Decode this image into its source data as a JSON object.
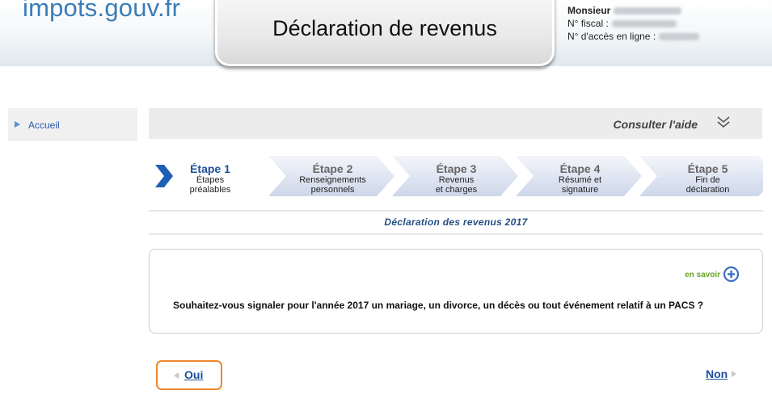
{
  "header": {
    "logo_text": "impots.gouv.fr",
    "title": "Déclaration de revenus",
    "user": {
      "name_label": "Monsieur",
      "fiscal_label": "N° fiscal :",
      "access_label": "N° d'accès en ligne :"
    }
  },
  "sidebar": {
    "items": [
      {
        "label": "Accueil"
      }
    ]
  },
  "help": {
    "label": "Consulter l'aide",
    "icon": "double-chevron-down-icon"
  },
  "steps": [
    {
      "num": "Étape 1",
      "desc_line1": "Étapes",
      "desc_line2": "préalables",
      "active": true
    },
    {
      "num": "Étape 2",
      "desc_line1": "Renseignements",
      "desc_line2": "personnels",
      "active": false
    },
    {
      "num": "Étape 3",
      "desc_line1": "Revenus",
      "desc_line2": "et charges",
      "active": false
    },
    {
      "num": "Étape 4",
      "desc_line1": "Résumé et",
      "desc_line2": "signature",
      "active": false
    },
    {
      "num": "Étape 5",
      "desc_line1": "Fin de",
      "desc_line2": "déclaration",
      "active": false
    }
  ],
  "section": {
    "title": "Déclaration des revenus 2017"
  },
  "question_box": {
    "more_label": "en savoir",
    "question": "Souhaitez-vous signaler pour l'année 2017 un mariage, un divorce, un décès ou tout événement relatif à un PACS ?"
  },
  "answers": {
    "yes_label": "Oui",
    "no_label": "Non"
  },
  "colors": {
    "accent_blue": "#1d4f9c",
    "logo_blue": "#3a7db8",
    "focus_orange": "#f0882d",
    "more_green": "#6aa32a"
  }
}
